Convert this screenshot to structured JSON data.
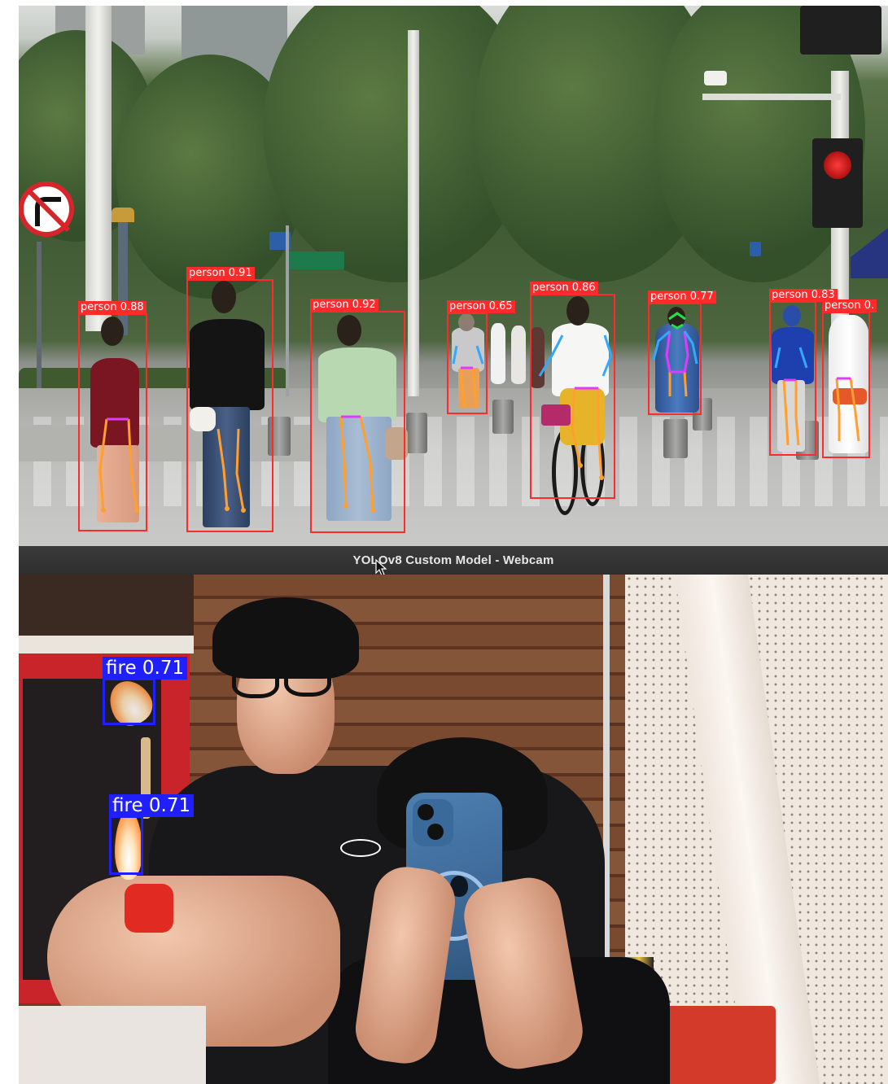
{
  "window": {
    "title": "YOLOv8 Custom Model - Webcam"
  },
  "street_detections": [
    {
      "label": "person 0.88"
    },
    {
      "label": "person 0.91"
    },
    {
      "label": "person 0.92"
    },
    {
      "label": "person 0.65"
    },
    {
      "label": "person 0.86"
    },
    {
      "label": "person 0.77"
    },
    {
      "label": "person 0.83"
    },
    {
      "label": "person 0."
    }
  ],
  "webcam_detections": [
    {
      "label": "fire 0.71"
    },
    {
      "label": "fire 0.71"
    }
  ],
  "colors": {
    "person_box": "#ff2a2a",
    "fire_box": "#2020ff",
    "skeleton_limb": "#ff9f2e",
    "skeleton_hip": "#e03bff",
    "skeleton_arm": "#33a8ff",
    "skeleton_head": "#23e04a"
  },
  "icons": [
    "no-right-turn-sign-icon",
    "traffic-light-icon",
    "mouse-cursor-icon",
    "apple-logo-icon"
  ]
}
